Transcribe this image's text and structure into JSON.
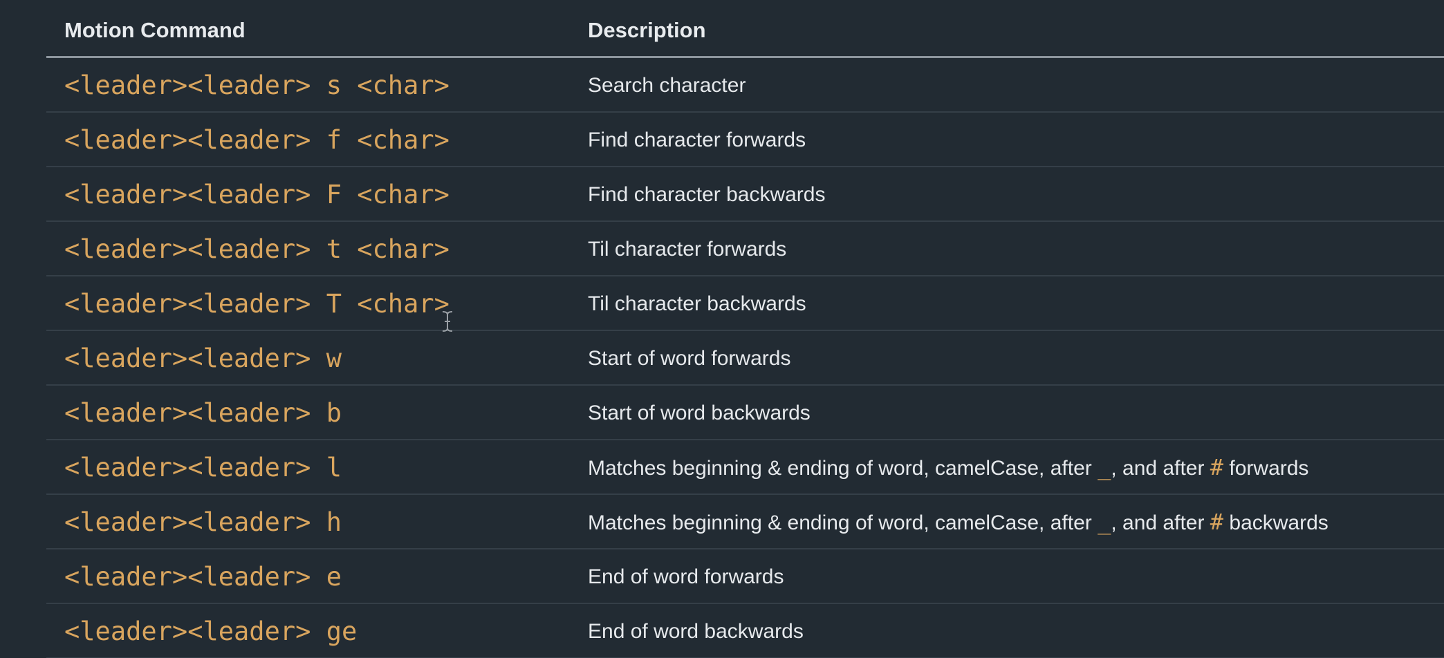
{
  "table": {
    "headers": {
      "command": "Motion Command",
      "description": "Description"
    },
    "rows": [
      {
        "command": "<leader><leader> s <char>",
        "description": "Search character"
      },
      {
        "command": "<leader><leader> f <char>",
        "description": "Find character forwards"
      },
      {
        "command": "<leader><leader> F <char>",
        "description": "Find character backwards"
      },
      {
        "command": "<leader><leader> t <char>",
        "description": "Til character forwards"
      },
      {
        "command": "<leader><leader> T <char>",
        "description": "Til character backwards"
      },
      {
        "command": "<leader><leader> w",
        "description": "Start of word forwards"
      },
      {
        "command": "<leader><leader> b",
        "description": "Start of word backwards"
      },
      {
        "command": "<leader><leader> l",
        "description_parts": {
          "a": "Matches beginning & ending of word, camelCase, after ",
          "code1": "_",
          "b": ", and after ",
          "code2": "#",
          "c": " forwards"
        }
      },
      {
        "command": "<leader><leader> h",
        "description_parts": {
          "a": "Matches beginning & ending of word, camelCase, after ",
          "code1": "_",
          "b": ", and after ",
          "code2": "#",
          "c": " backwards"
        }
      },
      {
        "command": "<leader><leader> e",
        "description": "End of word forwards"
      },
      {
        "command": "<leader><leader> ge",
        "description": "End of word backwards"
      }
    ]
  },
  "colors": {
    "background": "#222b33",
    "command_text": "#d9a55e",
    "description_text": "#e6e9ec",
    "header_rule": "#8d959d"
  },
  "icons": {
    "cursor": "text-cursor-icon"
  }
}
